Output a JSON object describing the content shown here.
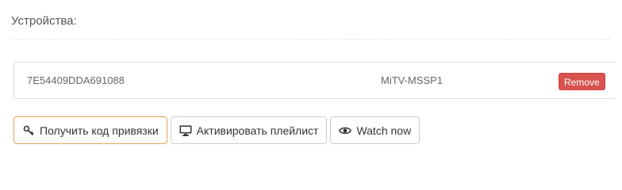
{
  "section": {
    "title": "Устройства:"
  },
  "devices": [
    {
      "id": "7E54409DDA691088",
      "name": "MiTV-MSSP1",
      "remove_label": "Remove"
    }
  ],
  "actions": {
    "get_link_code": {
      "label": "Получить код привязки",
      "icon": "key-icon"
    },
    "activate_playlist": {
      "label": "Активировать плейлист",
      "icon": "monitor-icon"
    },
    "watch_now": {
      "label": "Watch now",
      "icon": "eye-icon"
    }
  },
  "colors": {
    "remove_button": "#d9534f",
    "focus_border": "#e8a15b"
  }
}
